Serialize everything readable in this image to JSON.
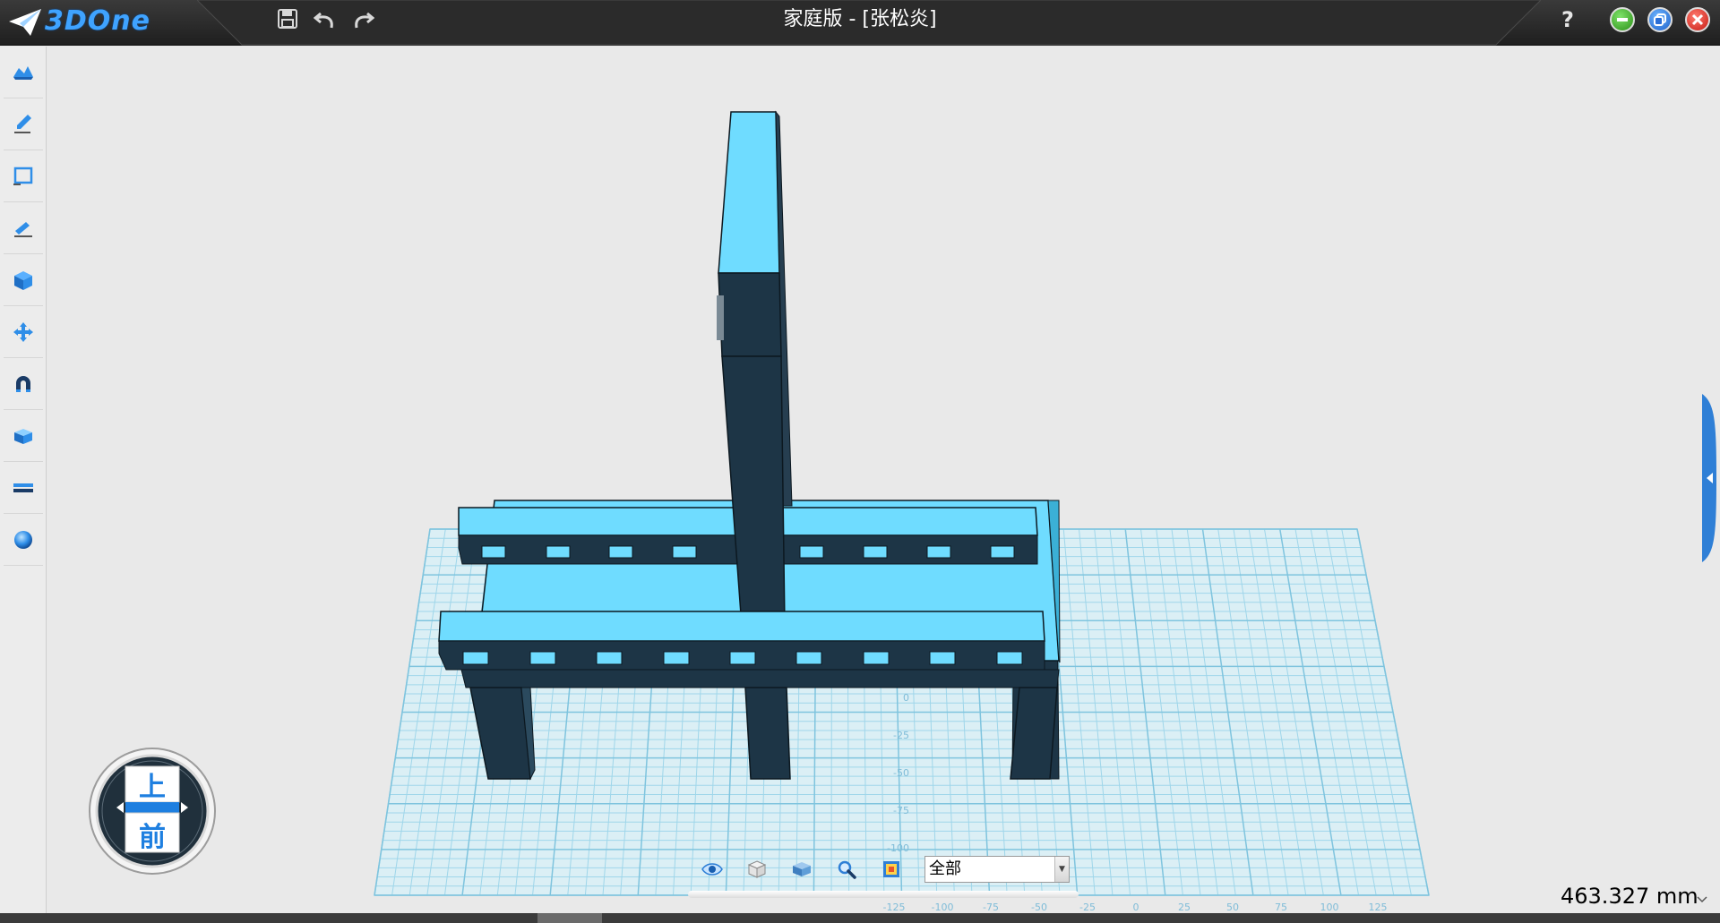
{
  "app": {
    "logo_text": "3DOne",
    "window_title": "家庭版 - [张松炎]"
  },
  "titlebar": {
    "save_label": "save",
    "undo_label": "undo",
    "redo_label": "redo",
    "help_label": "?"
  },
  "left_toolbar": {
    "items": [
      {
        "icon": "basic-solid-icon"
      },
      {
        "icon": "sketch-pen-icon"
      },
      {
        "icon": "sketch-rectangle-icon"
      },
      {
        "icon": "edit-sketch-icon"
      },
      {
        "icon": "special-feature-cube-icon"
      },
      {
        "icon": "move-arrows-icon"
      },
      {
        "icon": "magnet-icon"
      },
      {
        "icon": "combine-box-icon"
      },
      {
        "icon": "measure-ruler-icon"
      },
      {
        "icon": "material-sphere-icon"
      }
    ]
  },
  "view_cube": {
    "top_label": "上",
    "front_label": "前"
  },
  "grid": {
    "y_ticks": [
      "0",
      "-25",
      "-50",
      "-75",
      "-100"
    ],
    "x_ticks": [
      "-125",
      "-100",
      "-75",
      "-50",
      "-25",
      "0",
      "25",
      "50",
      "75",
      "100",
      "125"
    ]
  },
  "bottom_toolbar": {
    "icons": [
      "visibility-eye-icon",
      "wireframe-cube-icon",
      "shaded-box-icon",
      "zoom-magnifier-icon",
      "render-style-icon"
    ],
    "filter_value": "全部"
  },
  "readout": {
    "distance": "463.327 mm"
  },
  "colors": {
    "part_face": "#6fdcff",
    "part_dark": "#1d3546",
    "grid_line": "#8ccfe6",
    "accent": "#3fa3ff"
  }
}
